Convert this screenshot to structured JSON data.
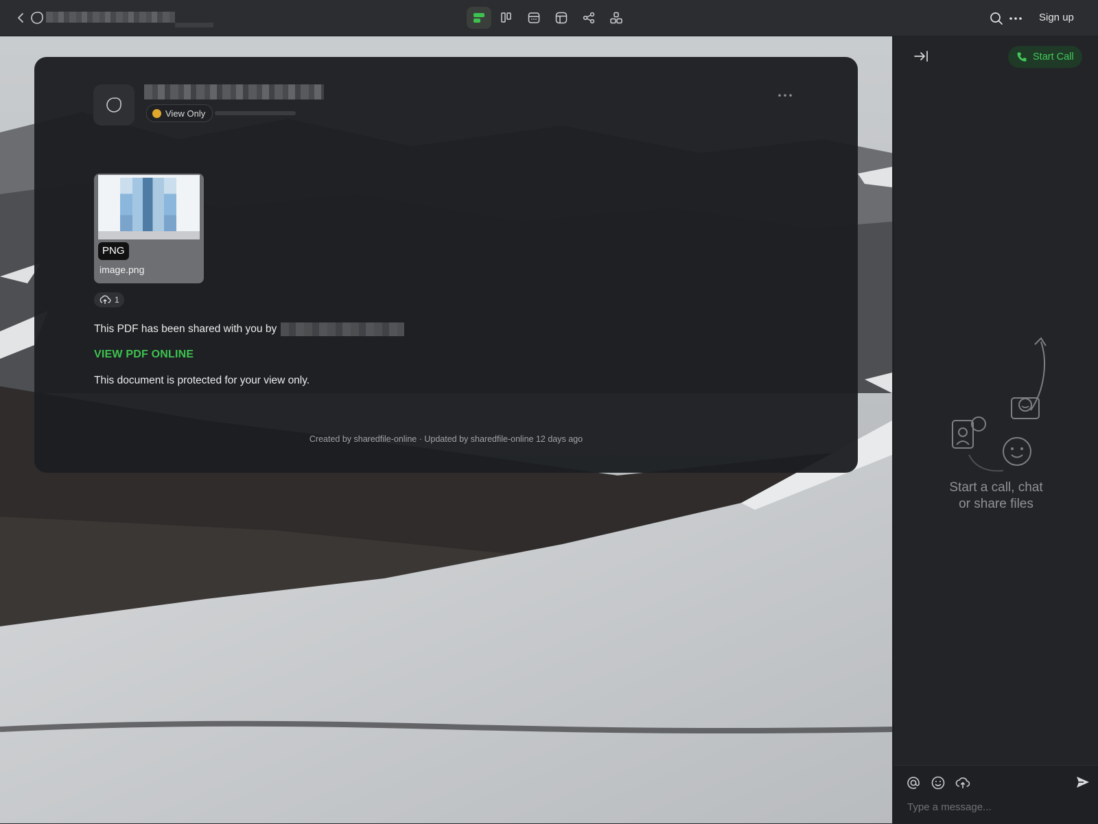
{
  "topbar": {
    "signup_label": "Sign up",
    "tools": [
      {
        "name": "tool-doc",
        "icon": "doc-view-icon",
        "active": true
      },
      {
        "name": "tool-board",
        "icon": "columns-icon",
        "active": false
      },
      {
        "name": "tool-calendar",
        "icon": "calendar-icon",
        "active": false
      },
      {
        "name": "tool-table",
        "icon": "table-icon",
        "active": false
      },
      {
        "name": "tool-graph",
        "icon": "share-graph-icon",
        "active": false
      },
      {
        "name": "tool-structure",
        "icon": "structure-icon",
        "active": false
      }
    ]
  },
  "card": {
    "badge_label": "View Only",
    "file": {
      "ext": "PNG",
      "name": "image.png"
    },
    "upload_count": "1",
    "shared_text": "This PDF has been shared with you by",
    "view_link": "VIEW PDF ONLINE",
    "protected_text": "This document is protected for your view only.",
    "footer": "Created by sharedfile-online · Updated by sharedfile-online 12 days ago"
  },
  "panel": {
    "start_call_label": "Start Call",
    "empty_text_line1": "Start a call, chat",
    "empty_text_line2": "or share files",
    "composer_placeholder": "Type a message..."
  },
  "colors": {
    "accent": "#3ec24f",
    "topbar_bg": "#2b2d30",
    "card_bg": "#1c1e21",
    "panel_bg": "#232427"
  }
}
